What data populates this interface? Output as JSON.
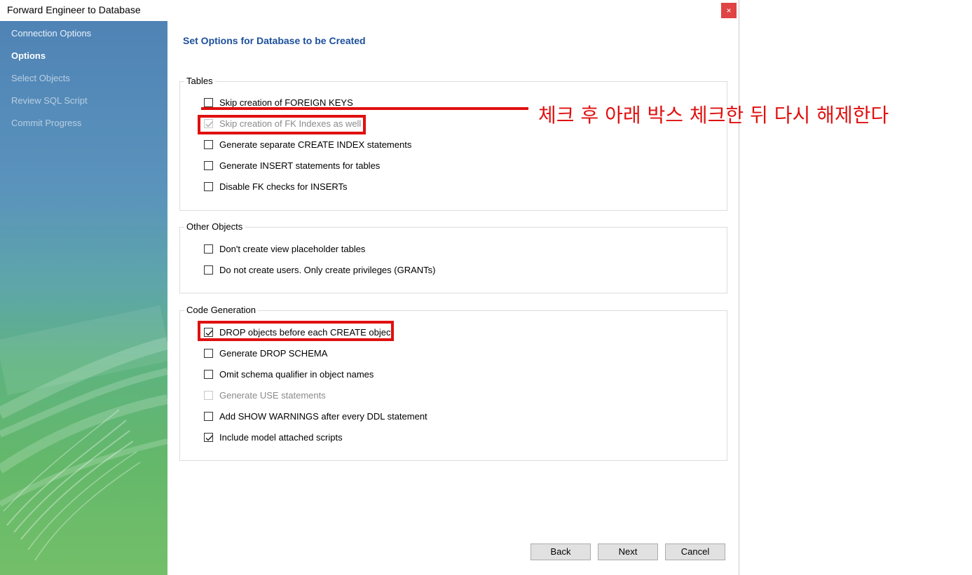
{
  "window": {
    "title": "Forward Engineer to Database",
    "close_glyph": "×"
  },
  "sidebar": {
    "items": [
      {
        "label": "Connection Options",
        "state": "done"
      },
      {
        "label": "Options",
        "state": "active"
      },
      {
        "label": "Select Objects",
        "state": "pending"
      },
      {
        "label": "Review SQL Script",
        "state": "pending"
      },
      {
        "label": "Commit Progress",
        "state": "pending"
      }
    ]
  },
  "main": {
    "heading": "Set Options for Database to be Created",
    "groups": [
      {
        "label": "Tables",
        "options": [
          {
            "label": "Skip creation of FOREIGN KEYS",
            "checked": false,
            "enabled": true
          },
          {
            "label": "Skip creation of FK Indexes as well",
            "checked": true,
            "enabled": false
          },
          {
            "label": "Generate separate CREATE INDEX statements",
            "checked": false,
            "enabled": true
          },
          {
            "label": "Generate INSERT statements for tables",
            "checked": false,
            "enabled": true
          },
          {
            "label": "Disable FK checks for INSERTs",
            "checked": false,
            "enabled": true
          }
        ]
      },
      {
        "label": "Other Objects",
        "options": [
          {
            "label": "Don't create view placeholder tables",
            "checked": false,
            "enabled": true
          },
          {
            "label": "Do not create users. Only create privileges (GRANTs)",
            "checked": false,
            "enabled": true
          }
        ]
      },
      {
        "label": "Code Generation",
        "options": [
          {
            "label": "DROP objects before each CREATE object",
            "checked": true,
            "enabled": true
          },
          {
            "label": "Generate DROP SCHEMA",
            "checked": false,
            "enabled": true
          },
          {
            "label": "Omit schema qualifier in object names",
            "checked": false,
            "enabled": true
          },
          {
            "label": "Generate USE statements",
            "checked": false,
            "enabled": false
          },
          {
            "label": "Add SHOW WARNINGS after every DDL statement",
            "checked": false,
            "enabled": true
          },
          {
            "label": "Include model attached scripts",
            "checked": true,
            "enabled": true
          }
        ]
      }
    ]
  },
  "annotation": {
    "text": "체크 후 아래 박스 체크한 뒤 다시 해제한다",
    "color": "#e01010"
  },
  "buttons": {
    "back": "Back",
    "next": "Next",
    "cancel": "Cancel"
  },
  "colors": {
    "heading": "#1c4f9b",
    "close": "#e04343",
    "highlight": "#e01010"
  }
}
